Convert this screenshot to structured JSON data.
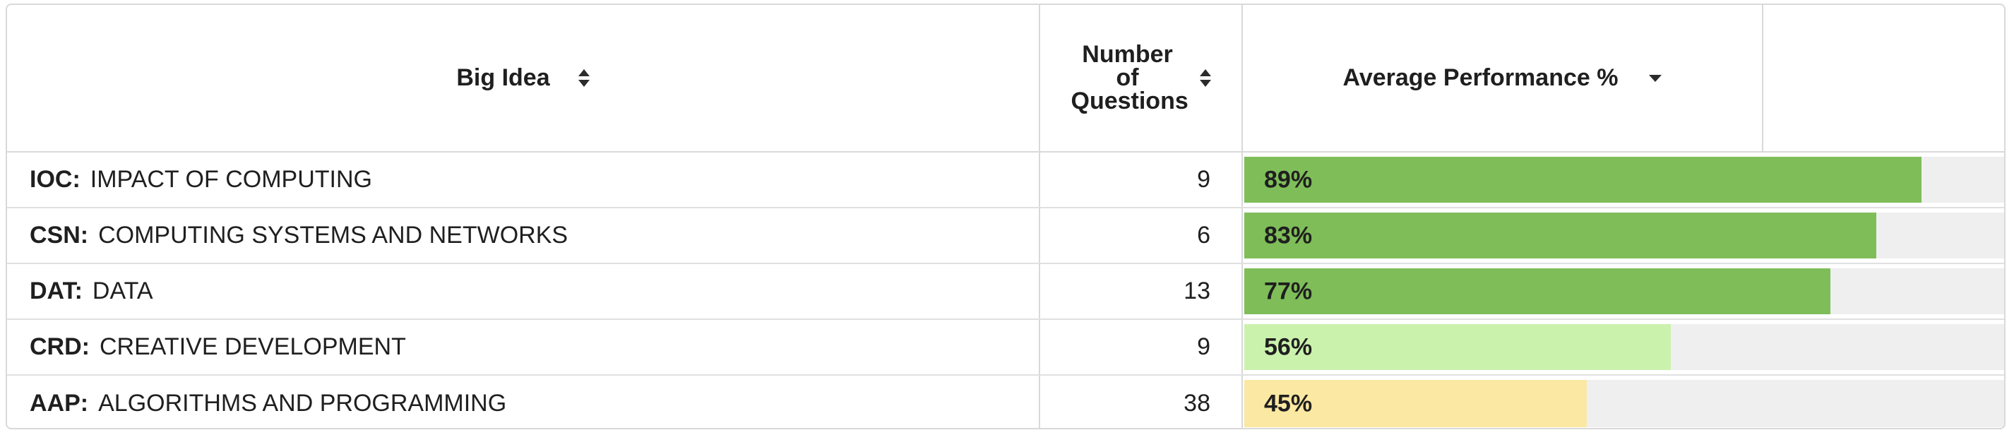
{
  "header": {
    "big_idea": "Big Idea",
    "num_questions": "Number of Questions",
    "avg_performance": "Average Performance %"
  },
  "icons": {
    "big_idea_sort": "sort-icon",
    "num_questions_sort": "sort-icon",
    "avg_performance_sort": "sort-descending-icon"
  },
  "colors": {
    "high": "#7fbd59",
    "medium": "#cbf2ad",
    "low": "#fbe8a2",
    "track": "#efefef"
  },
  "rows": [
    {
      "code": "IOC:",
      "name": "IMPACT OF COMPUTING",
      "questions": "9",
      "performance_label": "89%",
      "performance": 0.89,
      "level": "high"
    },
    {
      "code": "CSN:",
      "name": "COMPUTING SYSTEMS AND NETWORKS",
      "questions": "6",
      "performance_label": "83%",
      "performance": 0.83,
      "level": "high"
    },
    {
      "code": "DAT:",
      "name": "DATA",
      "questions": "13",
      "performance_label": "77%",
      "performance": 0.77,
      "level": "high"
    },
    {
      "code": "CRD:",
      "name": "CREATIVE DEVELOPMENT",
      "questions": "9",
      "performance_label": "56%",
      "performance": 0.56,
      "level": "medium"
    },
    {
      "code": "AAP:",
      "name": "ALGORITHMS AND PROGRAMMING",
      "questions": "38",
      "performance_label": "45%",
      "performance": 0.45,
      "level": "low"
    }
  ]
}
